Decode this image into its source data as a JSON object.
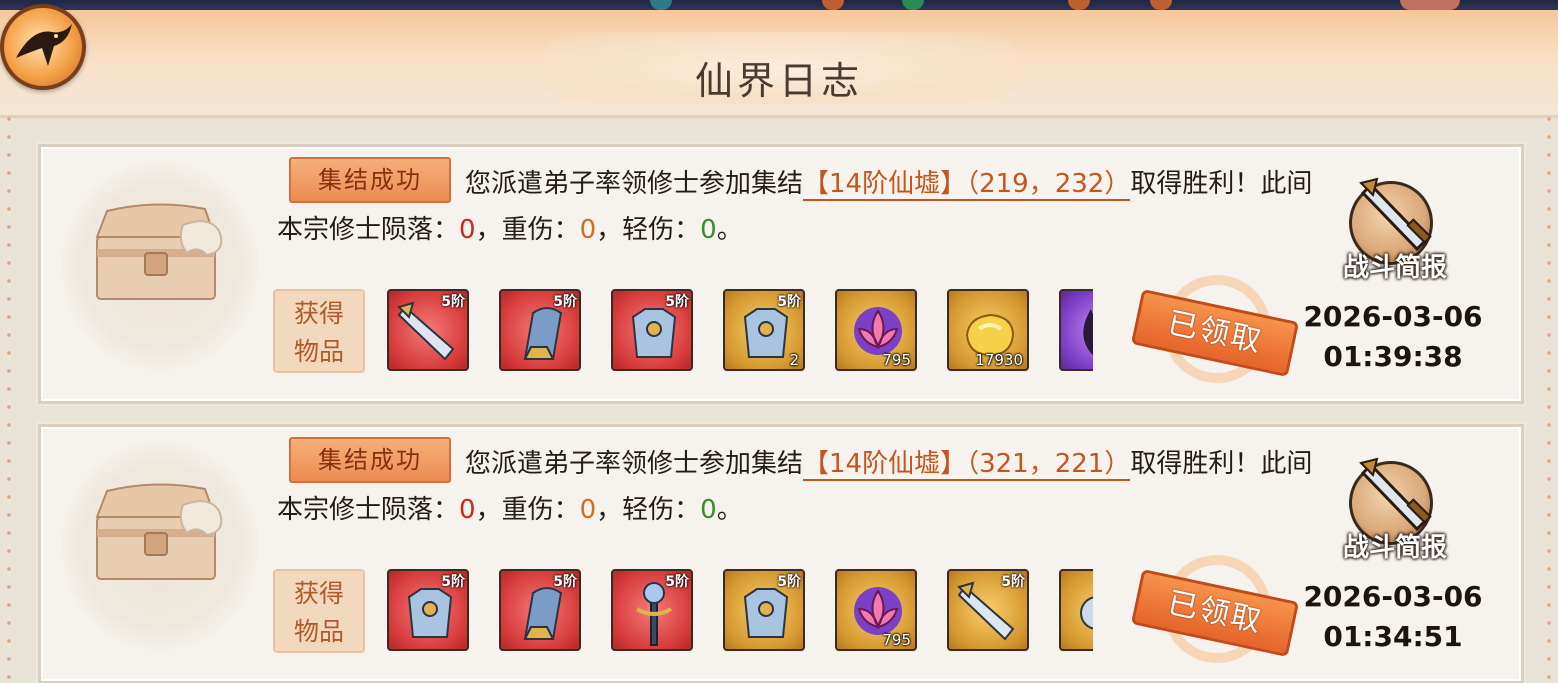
{
  "header": {
    "title": "仙界日志",
    "back_icon": "crow-back-icon"
  },
  "colors": {
    "loss_red": "#c8281e",
    "heavy_orange": "#d56c1a",
    "light_green": "#3a8b2a",
    "location_link": "#c4561d"
  },
  "logs": [
    {
      "status": "集结成功",
      "msg_prefix": "您派遣弟子率领修士参加集结",
      "location": "【14阶仙墟】（219，232）",
      "msg_mid": "取得胜利！此间本宗修士陨落：",
      "fallen": "0",
      "heavy_label": "，重伤：",
      "heavy": "0",
      "light_label": "，轻伤：",
      "light": "0",
      "msg_end": "。",
      "items_label_1": "获得",
      "items_label_2": "物品",
      "items": [
        {
          "icon": "sword-icon",
          "rarity": "red",
          "tier": "5阶",
          "qty": ""
        },
        {
          "icon": "helmet-icon",
          "rarity": "red",
          "tier": "5阶",
          "qty": ""
        },
        {
          "icon": "armor-icon",
          "rarity": "red",
          "tier": "5阶",
          "qty": ""
        },
        {
          "icon": "armor-icon",
          "rarity": "gold",
          "tier": "5阶",
          "qty": "2"
        },
        {
          "icon": "lotus-icon",
          "rarity": "gold",
          "tier": "",
          "qty": "795"
        },
        {
          "icon": "gold-ingot-icon",
          "rarity": "gold",
          "tier": "",
          "qty": "17930"
        },
        {
          "icon": "dark-flame-icon",
          "rarity": "purple",
          "tier": "",
          "qty": ""
        }
      ],
      "claimed": "已领取",
      "report_label": "战斗简报",
      "date": "2026-03-06",
      "time": "01:39:38"
    },
    {
      "status": "集结成功",
      "msg_prefix": "您派遣弟子率领修士参加集结",
      "location": "【14阶仙墟】（321，221）",
      "msg_mid": "取得胜利！此间本宗修士陨落：",
      "fallen": "0",
      "heavy_label": "，重伤：",
      "heavy": "0",
      "light_label": "，轻伤：",
      "light": "0",
      "msg_end": "。",
      "items_label_1": "获得",
      "items_label_2": "物品",
      "items": [
        {
          "icon": "armor-icon",
          "rarity": "red",
          "tier": "5阶",
          "qty": ""
        },
        {
          "icon": "helmet-icon",
          "rarity": "red",
          "tier": "5阶",
          "qty": ""
        },
        {
          "icon": "staff-icon",
          "rarity": "red",
          "tier": "5阶",
          "qty": ""
        },
        {
          "icon": "armor-icon",
          "rarity": "gold",
          "tier": "5阶",
          "qty": ""
        },
        {
          "icon": "lotus-icon",
          "rarity": "gold",
          "tier": "",
          "qty": "795"
        },
        {
          "icon": "sword-icon",
          "rarity": "gold",
          "tier": "5阶",
          "qty": ""
        },
        {
          "icon": "orb-icon",
          "rarity": "gold",
          "tier": "",
          "qty": ""
        }
      ],
      "claimed": "已领取",
      "report_label": "战斗简报",
      "date": "2026-03-06",
      "time": "01:34:51"
    }
  ]
}
